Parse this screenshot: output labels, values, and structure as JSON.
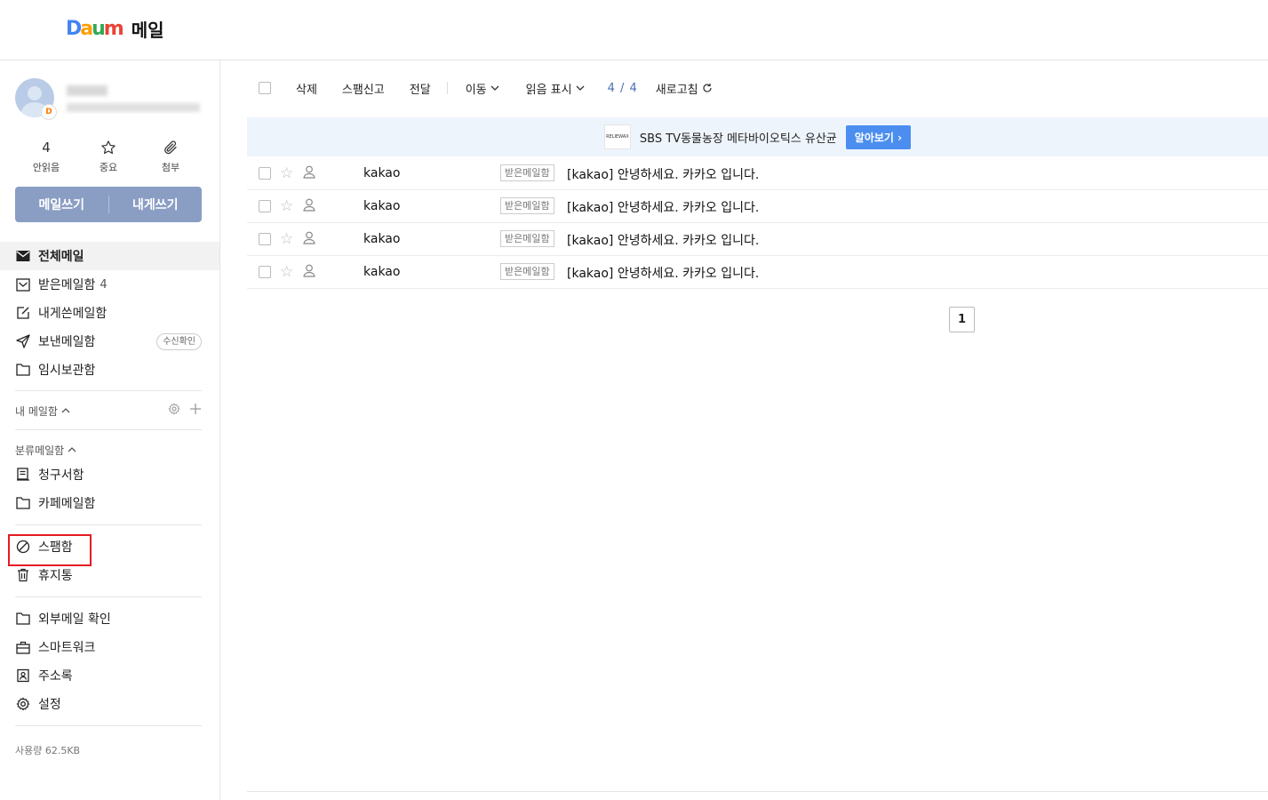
{
  "header": {
    "logo_letters": [
      "D",
      "a",
      "u",
      "m"
    ],
    "title": "메일"
  },
  "sidebar": {
    "avatar_badge": "D",
    "quick": [
      {
        "value": "4",
        "label": "안읽음",
        "icon": "count"
      },
      {
        "value": "",
        "label": "중요",
        "icon": "star-icon"
      },
      {
        "value": "",
        "label": "첨부",
        "icon": "paperclip-icon"
      }
    ],
    "write_button": "메일쓰기",
    "self_write_button": "내게쓰기",
    "folders": [
      {
        "label": "전체메일",
        "icon": "envelope-icon",
        "active": true
      },
      {
        "label": "받은메일함",
        "icon": "inbox-icon",
        "count": "4"
      },
      {
        "label": "내게쓴메일함",
        "icon": "note-icon"
      },
      {
        "label": "보낸메일함",
        "icon": "send-icon",
        "badge": "수신확인"
      },
      {
        "label": "임시보관함",
        "icon": "folder-icon"
      }
    ],
    "my_mailbox_label": "내 메일함",
    "category_label": "분류메일함",
    "category_folders": [
      {
        "label": "청구서함",
        "icon": "receipt-icon"
      },
      {
        "label": "카페메일함",
        "icon": "folder-icon"
      }
    ],
    "spam_trash": [
      {
        "label": "스팸함",
        "icon": "block-icon"
      },
      {
        "label": "휴지통",
        "icon": "trash-icon"
      }
    ],
    "extras": [
      {
        "label": "외부메일 확인",
        "icon": "folder-icon"
      },
      {
        "label": "스마트워크",
        "icon": "briefcase-icon"
      },
      {
        "label": "주소록",
        "icon": "contact-icon"
      },
      {
        "label": "설정",
        "icon": "gear-icon"
      }
    ],
    "usage": "사용량 62.5KB"
  },
  "toolbar": {
    "delete": "삭제",
    "spam_report": "스팸신고",
    "forward": "전달",
    "move": "이동",
    "mark_read": "읽음 표시",
    "count": "4 / 4",
    "refresh": "새로고침"
  },
  "ad": {
    "logo_text": "RELIEWAX",
    "text": "SBS TV동물농장 메타바이오틱스 유산균",
    "button": "알아보기"
  },
  "mails": [
    {
      "sender": "kakao",
      "tag": "받은메일함",
      "subject": "[kakao] 안녕하세요. 카카오 입니다."
    },
    {
      "sender": "kakao",
      "tag": "받은메일함",
      "subject": "[kakao] 안녕하세요. 카카오 입니다."
    },
    {
      "sender": "kakao",
      "tag": "받은메일함",
      "subject": "[kakao] 안녕하세요. 카카오 입니다."
    },
    {
      "sender": "kakao",
      "tag": "받은메일함",
      "subject": "[kakao] 안녕하세요. 카카오 입니다."
    }
  ],
  "pagination": {
    "current": "1"
  },
  "colors": {
    "accent": "#4b8ef0",
    "write_button": "#8a9ec4",
    "highlight": "#e51c23"
  }
}
